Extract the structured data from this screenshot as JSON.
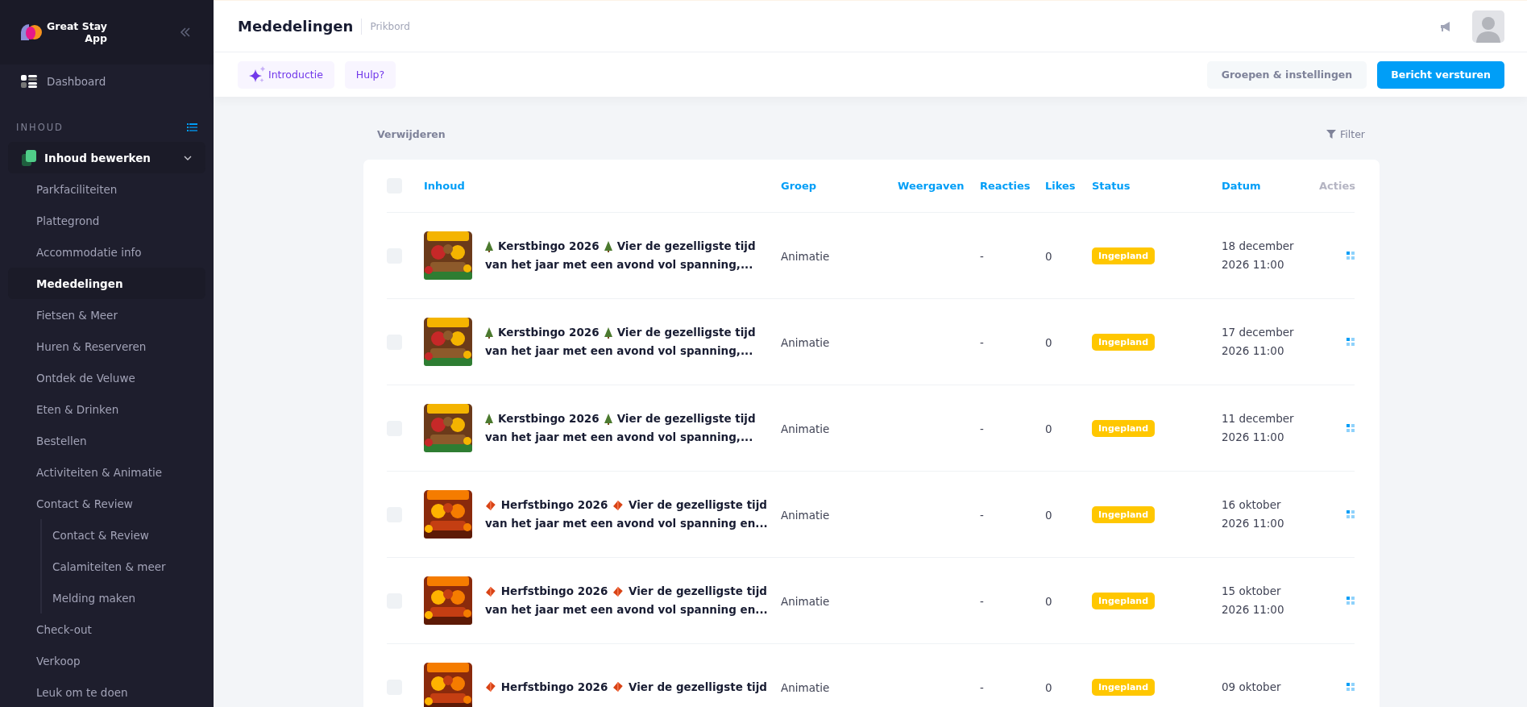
{
  "sidebar": {
    "brand": {
      "line1": "Great Stay",
      "line2": "App"
    },
    "items": [
      {
        "label": "Dashboard",
        "selected": false
      }
    ],
    "section": "INHOUD",
    "group": {
      "label": "Inhoud bewerken",
      "expanded": true,
      "children": [
        {
          "label": "Parkfaciliteiten",
          "selected": false
        },
        {
          "label": "Plattegrond",
          "selected": false
        },
        {
          "label": "Accommodatie info",
          "selected": false
        },
        {
          "label": "Mededelingen",
          "selected": true
        },
        {
          "label": "Fietsen & Meer",
          "selected": false
        },
        {
          "label": "Huren & Reserveren",
          "selected": false
        },
        {
          "label": "Ontdek de Veluwe",
          "selected": false
        },
        {
          "label": "Eten & Drinken",
          "selected": false
        },
        {
          "label": "Bestellen",
          "selected": false
        },
        {
          "label": "Activiteiten & Animatie",
          "selected": false
        },
        {
          "label": "Contact & Review",
          "selected": false,
          "children": [
            {
              "label": "Contact & Review",
              "selected": false
            },
            {
              "label": "Calamiteiten & meer",
              "selected": false
            },
            {
              "label": "Melding maken",
              "selected": false
            }
          ]
        },
        {
          "label": "Check-out",
          "selected": false
        },
        {
          "label": "Verkoop",
          "selected": false
        },
        {
          "label": "Leuk om te doen",
          "selected": false
        }
      ]
    }
  },
  "header": {
    "title": "Mededelingen",
    "subtitle": "Prikbord"
  },
  "toolbar": {
    "left": [
      {
        "label": "Introductie",
        "kind": "sparkle"
      },
      {
        "label": "Hulp?",
        "kind": "plain"
      }
    ],
    "right": [
      {
        "label": "Groepen & instellingen",
        "kind": "secondary"
      },
      {
        "label": "Bericht versturen",
        "kind": "primary"
      }
    ]
  },
  "bulk": {
    "delete": "Verwijderen",
    "filter": "Filter"
  },
  "table": {
    "select_all": {
      "checked": false
    },
    "columns": [
      {
        "label": "Inhoud",
        "sortable": true
      },
      {
        "label": "Groep",
        "sortable": true
      },
      {
        "label": "Weergaven",
        "sortable": true
      },
      {
        "label": "Reacties",
        "sortable": true
      },
      {
        "label": "Likes",
        "sortable": true
      },
      {
        "label": "Status",
        "sortable": true
      },
      {
        "label": "Datum",
        "sortable": true
      },
      {
        "label": "Acties",
        "sortable": false
      }
    ],
    "rows": [
      {
        "checked": false,
        "kind": "christmas",
        "title": "Kerstbingo 2026",
        "text": [
          "Vier de gezelligste tijd",
          "van het jaar met een avond vol spanning,..."
        ],
        "group": "Animatie",
        "reactions": "-",
        "likes": "0",
        "status": {
          "label": "Ingepland",
          "kind": "scheduled"
        },
        "date": "18 december 2026 11:00"
      },
      {
        "checked": false,
        "kind": "christmas",
        "title": "Kerstbingo 2026",
        "text": [
          "Vier de gezelligste tijd",
          "van het jaar met een avond vol spanning,..."
        ],
        "group": "Animatie",
        "reactions": "-",
        "likes": "0",
        "status": {
          "label": "Ingepland",
          "kind": "scheduled"
        },
        "date": "17 december 2026 11:00"
      },
      {
        "checked": false,
        "kind": "christmas",
        "title": "Kerstbingo 2026",
        "text": [
          "Vier de gezelligste tijd",
          "van het jaar met een avond vol spanning,..."
        ],
        "group": "Animatie",
        "reactions": "-",
        "likes": "0",
        "status": {
          "label": "Ingepland",
          "kind": "scheduled"
        },
        "date": "11 december 2026 11:00"
      },
      {
        "checked": false,
        "kind": "autumn",
        "title": "Herfstbingo 2026",
        "text": [
          "Vier de gezelligste tijd",
          "van het jaar met een avond vol spanning en..."
        ],
        "group": "Animatie",
        "reactions": "-",
        "likes": "0",
        "status": {
          "label": "Ingepland",
          "kind": "scheduled"
        },
        "date": "16 oktober 2026 11:00"
      },
      {
        "checked": false,
        "kind": "autumn",
        "title": "Herfstbingo 2026",
        "text": [
          "Vier de gezelligste tijd",
          "van het jaar met een avond vol spanning en..."
        ],
        "group": "Animatie",
        "reactions": "-",
        "likes": "0",
        "status": {
          "label": "Ingepland",
          "kind": "scheduled"
        },
        "date": "15 oktober 2026 11:00"
      },
      {
        "checked": false,
        "kind": "autumn",
        "title": "Herfstbingo 2026",
        "text": [
          "Vier de gezelligste tijd"
        ],
        "group": "Animatie",
        "reactions": "-",
        "likes": "0",
        "status": {
          "label": "Ingepland",
          "kind": "scheduled"
        },
        "date": "09 oktober"
      }
    ]
  }
}
